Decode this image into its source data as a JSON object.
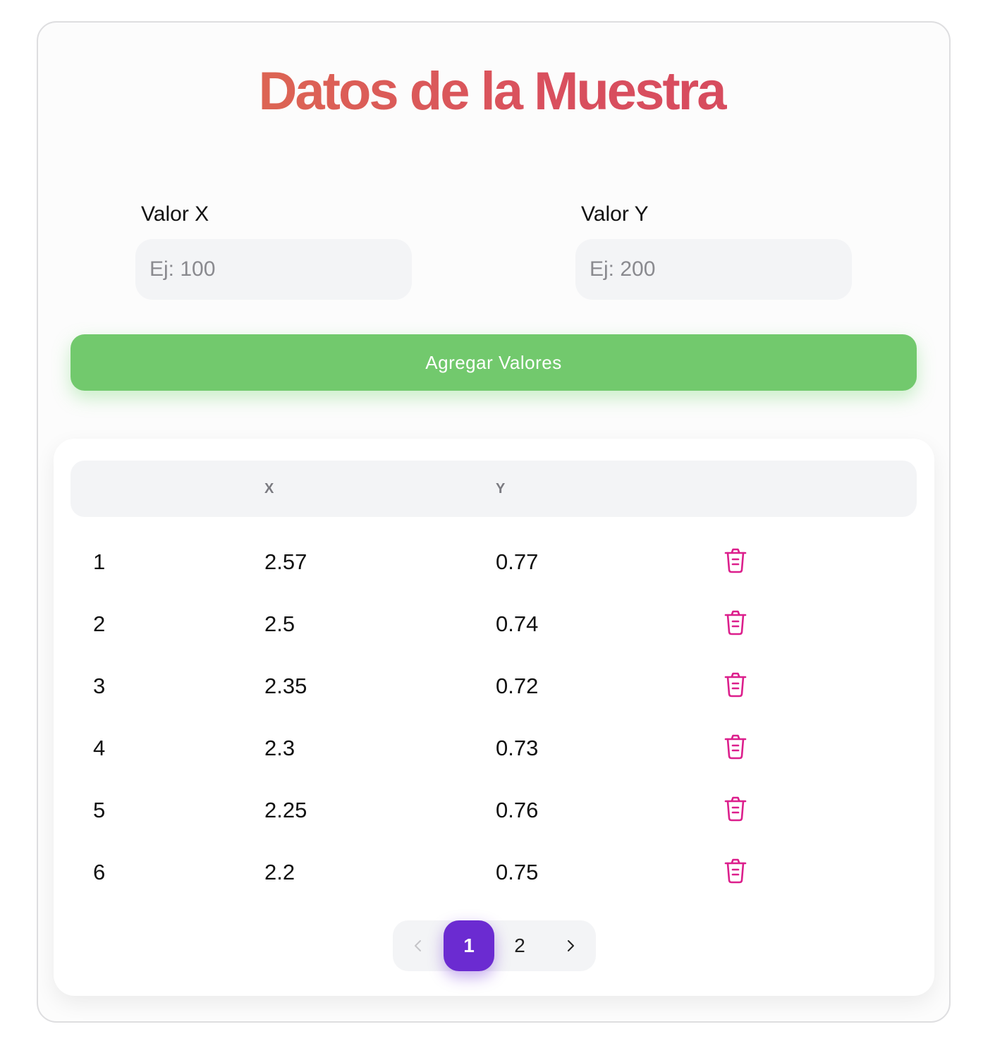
{
  "title": "Datos de la Muestra",
  "form": {
    "x_label": "Valor X",
    "x_placeholder": "Ej: 100",
    "y_label": "Valor Y",
    "y_placeholder": "Ej: 200",
    "add_button": "Agregar Valores"
  },
  "table": {
    "headers": [
      "",
      "X",
      "Y",
      ""
    ],
    "rows": [
      {
        "index": "1",
        "x": "2.57",
        "y": "0.77"
      },
      {
        "index": "2",
        "x": "2.5",
        "y": "0.74"
      },
      {
        "index": "3",
        "x": "2.35",
        "y": "0.72"
      },
      {
        "index": "4",
        "x": "2.3",
        "y": "0.73"
      },
      {
        "index": "5",
        "x": "2.25",
        "y": "0.76"
      },
      {
        "index": "6",
        "x": "2.2",
        "y": "0.75"
      }
    ],
    "delete_icon": "trash-icon"
  },
  "pagination": {
    "prev_icon": "chevron-left-icon",
    "pages": [
      "1",
      "2"
    ],
    "current_page": "1",
    "next_icon": "chevron-right-icon"
  },
  "colors": {
    "title_gradient_start": "#e0784a",
    "title_gradient_end": "#d4455e",
    "add_button": "#72c96d",
    "delete_icon": "#dc1f8c",
    "active_page": "#6b2bd1"
  }
}
